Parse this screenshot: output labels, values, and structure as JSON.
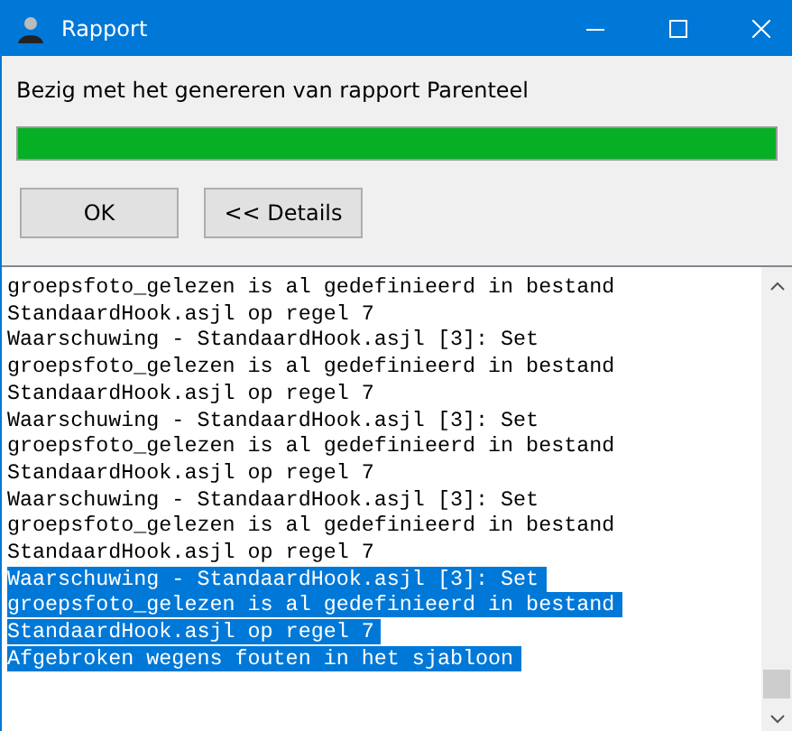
{
  "window": {
    "title": "Rapport"
  },
  "status_text": "Bezig met het genereren van rapport Parenteel",
  "progress": {
    "level": 1
  },
  "buttons": [
    "OK",
    "<< Details"
  ],
  "log": [
    {
      "text": "groepsfoto_gelezen is al gedefinieerd in bestand",
      "selected": false
    },
    {
      "text": "StandaardHook.asjl op regel 7",
      "selected": false
    },
    {
      "text": "Waarschuwing - StandaardHook.asjl [3]: Set",
      "selected": false
    },
    {
      "text": "groepsfoto_gelezen is al gedefinieerd in bestand",
      "selected": false
    },
    {
      "text": "StandaardHook.asjl op regel 7",
      "selected": false
    },
    {
      "text": "Waarschuwing - StandaardHook.asjl [3]: Set",
      "selected": false
    },
    {
      "text": "groepsfoto_gelezen is al gedefinieerd in bestand",
      "selected": false
    },
    {
      "text": "StandaardHook.asjl op regel 7",
      "selected": false
    },
    {
      "text": "Waarschuwing - StandaardHook.asjl [3]: Set",
      "selected": false
    },
    {
      "text": "groepsfoto_gelezen is al gedefinieerd in bestand",
      "selected": false
    },
    {
      "text": "StandaardHook.asjl op regel 7",
      "selected": false
    },
    {
      "text": "Waarschuwing - StandaardHook.asjl [3]: Set",
      "selected": true
    },
    {
      "text": "groepsfoto_gelezen is al gedefinieerd in bestand",
      "selected": true
    },
    {
      "text": "StandaardHook.asjl op regel 7",
      "selected": true
    },
    {
      "text": "Afgebroken wegens fouten in het sjabloon",
      "selected": true
    }
  ]
}
